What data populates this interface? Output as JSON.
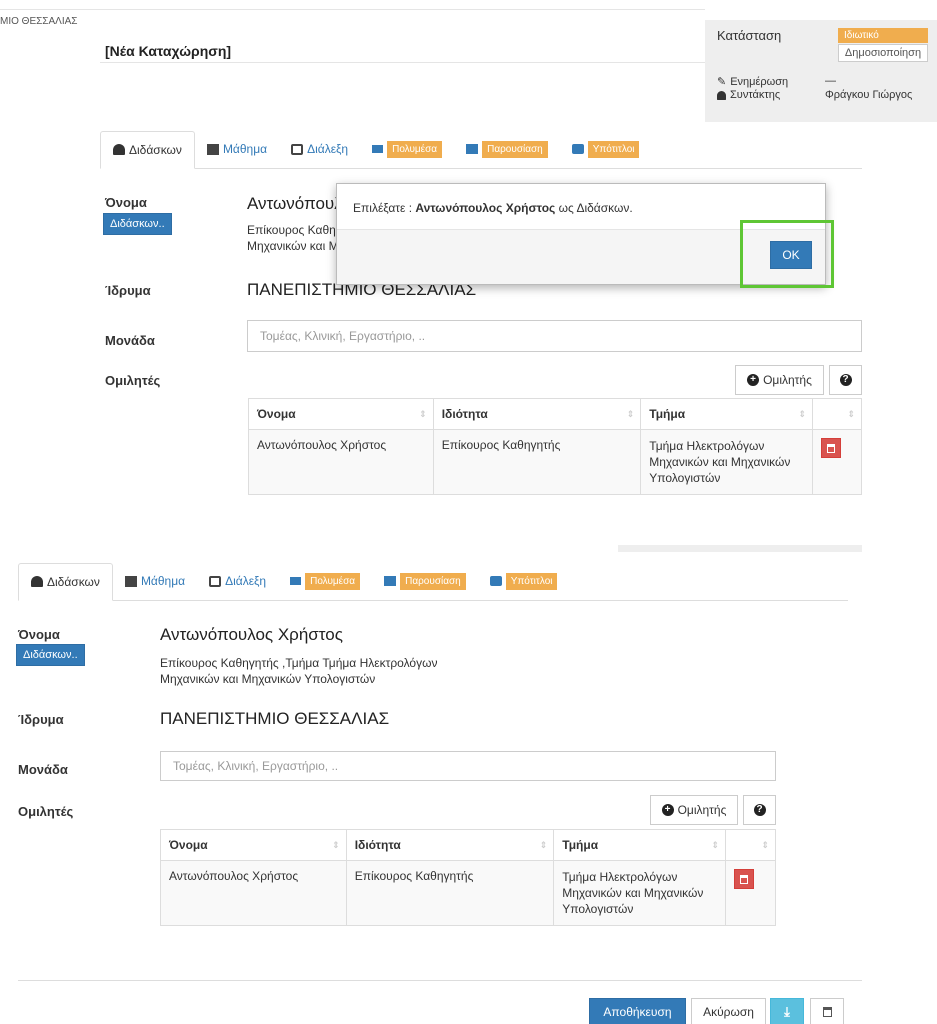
{
  "header": {
    "org_label": "ΜΙΟ ΘΕΣΣΑΛΙΑΣ",
    "title": "[Νέα Καταχώρηση]"
  },
  "side_panel": {
    "status_label": "Κατάσταση",
    "status_badge": "Ιδιωτικό",
    "publish_button": "Δημοσιοποίηση",
    "updated_label": "Ενημέρωση",
    "updated_value": "—",
    "author_label": "Συντάκτης",
    "author_value": "Φράγκου Γιώργος"
  },
  "tabs": {
    "instructor": "Διδάσκων",
    "course": "Μάθημα",
    "lecture": "Διάλεξη",
    "multimedia": "Πολυμέσα",
    "presentation": "Παρουσίαση",
    "subtitles": "Υπότιτλοι"
  },
  "form": {
    "name_label": "Όνομα",
    "instructor_button": "Διδάσκων..",
    "instructor_name": "Αντωνόπουλος Χρήστος",
    "instructor_name_partial": "Αντωνόπουλ",
    "instructor_detail_line1": "Επίκουρος Καθηγητής ,Τμήμα Τμήμα Ηλεκτρολόγων",
    "instructor_detail_line2": "Μηχανικών και Μηχανικών Υπολογιστών",
    "instructor_detail_partial1": "Επίκουρος Καθη",
    "instructor_detail_partial2": "Μηχανικών και Μ",
    "institution_label": "Ίδρυμα",
    "institution_value": "ΠΑΝΕΠΙΣΤΗΜΙΟ ΘΕΣΣΑΛΙΑΣ",
    "unit_label": "Μονάδα",
    "unit_placeholder": "Τομέας, Κλινική, Εργαστήριο, ..",
    "speakers_label": "Ομιλητές",
    "add_speaker_button": "Ομιλητής",
    "help_icon_text": "?"
  },
  "speakers_table": {
    "headers": [
      "Όνομα",
      "Ιδιότητα",
      "Τμήμα"
    ],
    "rows": [
      {
        "name": "Αντωνόπουλος Χρήστος",
        "role": "Επίκουρος Καθηγητής",
        "dept_line1": "Τμήμα Ηλεκτρολόγων",
        "dept_line2": "Μηχανικών και Μηχανικών",
        "dept_line3": "Υπολογιστών"
      }
    ],
    "sort_glyph": "⇕"
  },
  "dialog": {
    "message_prefix": "Επιλέξατε : ",
    "message_name": "Αντωνόπουλος Χρήστος",
    "message_suffix": " ως Διδάσκων.",
    "ok_button": "OK"
  },
  "footer": {
    "save_button": "Αποθήκευση",
    "cancel_button": "Ακύρωση"
  },
  "colors": {
    "primary": "#337ab7",
    "warning": "#f0ad4e",
    "danger": "#d9534f",
    "highlight": "#5ec634"
  }
}
